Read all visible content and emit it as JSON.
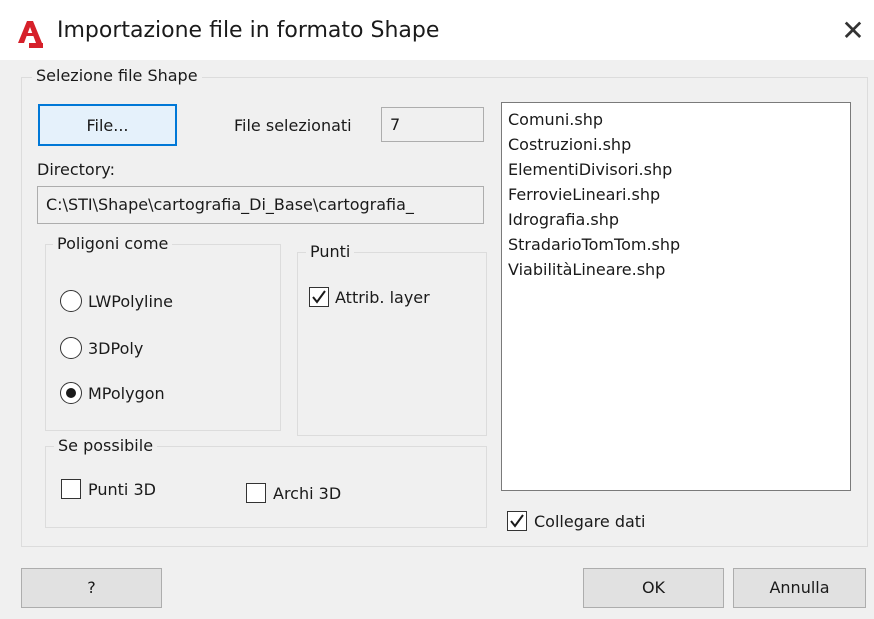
{
  "window": {
    "title": "Importazione file in formato Shape",
    "close_label": "✕",
    "app_icon": "autocad-icon"
  },
  "main_group": {
    "label": "Selezione file Shape",
    "file_button": "File...",
    "files_selected_label": "File selezionati",
    "files_selected_count": "7",
    "directory_label": "Directory:",
    "directory_value": "C:\\STI\\Shape\\cartografia_Di_Base\\cartografia_"
  },
  "polygons_group": {
    "label": "Poligoni come",
    "options": [
      {
        "label": "LWPolyline",
        "selected": false
      },
      {
        "label": "3DPoly",
        "selected": false
      },
      {
        "label": "MPolygon",
        "selected": true
      }
    ]
  },
  "points_group": {
    "label": "Punti",
    "attrib_layer_label": "Attrib. layer",
    "attrib_layer_checked": true
  },
  "if_possible_group": {
    "label": "Se possibile",
    "points3d_label": "Punti 3D",
    "points3d_checked": false,
    "arcs3d_label": "Archi 3D",
    "arcs3d_checked": false
  },
  "file_list": [
    "Comuni.shp",
    "Costruzioni.shp",
    "ElementiDivisori.shp",
    "FerrovieLineari.shp",
    "Idrografia.shp",
    "StradarioTomTom.shp",
    "ViabilitàLineare.shp"
  ],
  "link_data": {
    "label": "Collegare dati",
    "checked": true
  },
  "footer": {
    "help_label": "?",
    "ok_label": "OK",
    "cancel_label": "Annulla"
  }
}
